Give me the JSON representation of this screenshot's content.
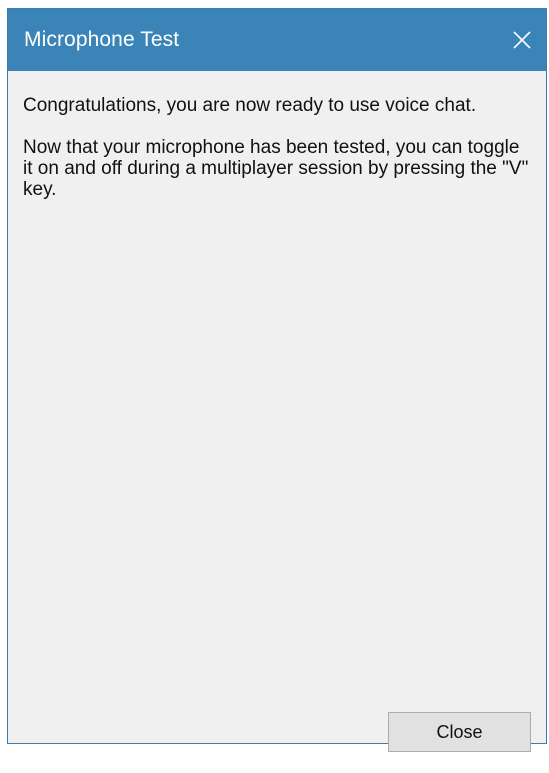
{
  "window": {
    "title": "Microphone Test",
    "title_bar_color": "#3b84b8",
    "close_icon": "close-icon"
  },
  "message": {
    "line1": "Congratulations, you are now ready to use voice chat.",
    "line2": "Now that your microphone has been tested, you can toggle it on and off during a multiplayer session by pressing the \"V\" key."
  },
  "buttons": {
    "close_label": "Close"
  }
}
